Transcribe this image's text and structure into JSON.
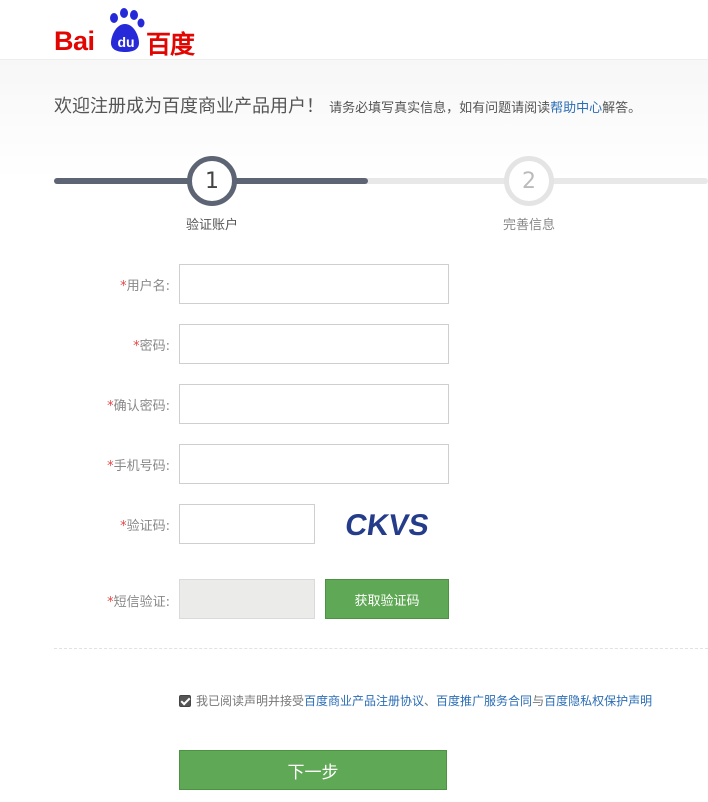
{
  "header": {
    "logo": {
      "latin": "Bai",
      "du": "du",
      "chinese": "百度"
    }
  },
  "welcome": {
    "title": "欢迎注册成为百度商业产品用户！",
    "hint_prefix": "请务必填写真实信息，如有问题请阅读",
    "help_link": "帮助中心",
    "hint_suffix": "解答。"
  },
  "steps": [
    {
      "number": "1",
      "label": "验证账户",
      "active": true
    },
    {
      "number": "2",
      "label": "完善信息",
      "active": false
    }
  ],
  "progress": {
    "fraction": 0.48
  },
  "form": {
    "required_mark": "*",
    "username": {
      "label": "用户名:",
      "value": ""
    },
    "password": {
      "label": "密码:",
      "value": ""
    },
    "confirm_password": {
      "label": "确认密码:",
      "value": ""
    },
    "phone": {
      "label": "手机号码:",
      "value": ""
    },
    "captcha": {
      "label": "验证码:",
      "value": "",
      "image_text": "CKVS"
    },
    "sms": {
      "label": "短信验证:",
      "value": "",
      "button_label": "获取验证码"
    }
  },
  "agreement": {
    "checked": true,
    "prefix": "我已阅读声明并接受",
    "link1": "百度商业产品注册协议",
    "separator": "、",
    "link2": "百度推广服务合同",
    "conjunction": "与",
    "link3": "百度隐私权保护声明"
  },
  "next_button": {
    "label": "下一步"
  },
  "colors": {
    "brand_red": "#e10602",
    "brand_blue": "#2529d8",
    "button_green": "#5fa855",
    "link_blue": "#2a6db5",
    "progress_dark": "#5d6473",
    "required_red": "#e64545"
  }
}
